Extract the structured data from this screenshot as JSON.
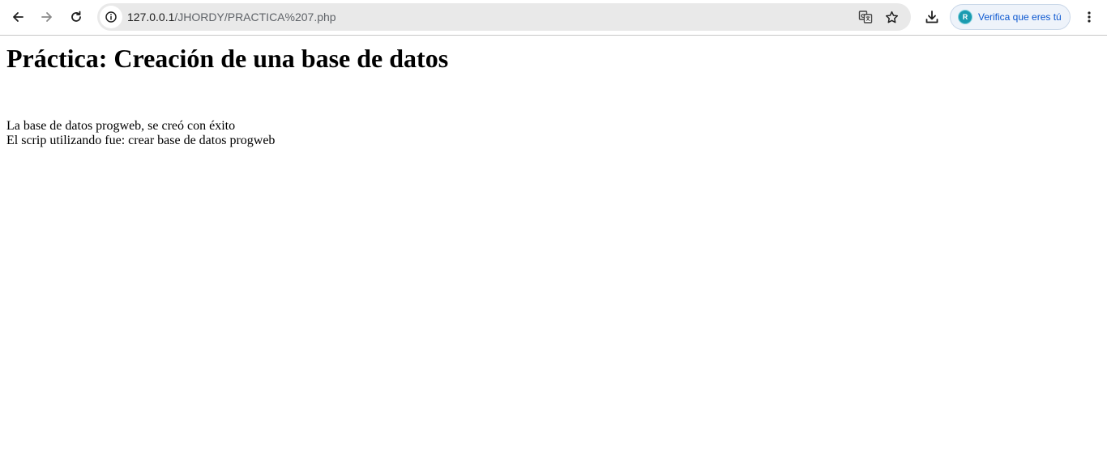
{
  "browser": {
    "url_host": "127.0.0.1",
    "url_path": "/JHORDY/PRACTICA%207.php",
    "profile_chip": {
      "avatar_letter": "R",
      "label": "Verifica que eres tú"
    },
    "icons": {
      "back": "arrow-left-icon",
      "forward": "arrow-right-icon",
      "reload": "reload-icon",
      "site_info": "info-icon",
      "translate": "translate-icon",
      "bookmark": "star-icon",
      "download": "download-icon",
      "menu": "three-dots-vertical-icon"
    }
  },
  "page": {
    "title": "Práctica: Creación de una base de datos",
    "lines": [
      "La base de datos progweb, se creó con éxito",
      "El scrip utilizando fue: crear base de datos progweb"
    ]
  }
}
